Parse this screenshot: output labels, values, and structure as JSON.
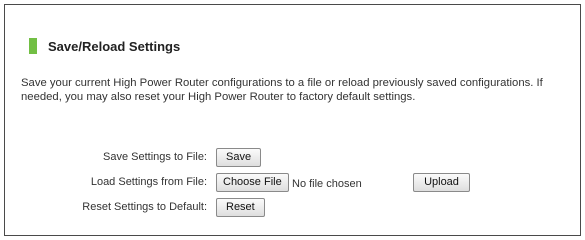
{
  "colors": {
    "accent": "#72bf44",
    "frame_border": "#4a4a4a"
  },
  "section": {
    "title": "Save/Reload Settings",
    "description": "Save your current High Power Router configurations to a file or reload previously saved configurations. If needed, you may also reset your High Power Router to factory default settings."
  },
  "rows": {
    "save": {
      "label": "Save Settings to File:",
      "button": "Save"
    },
    "load": {
      "label": "Load Settings from File:",
      "choose_button": "Choose File",
      "file_status": "No file chosen",
      "upload_button": "Upload"
    },
    "reset": {
      "label": "Reset Settings to Default:",
      "button": "Reset"
    }
  }
}
